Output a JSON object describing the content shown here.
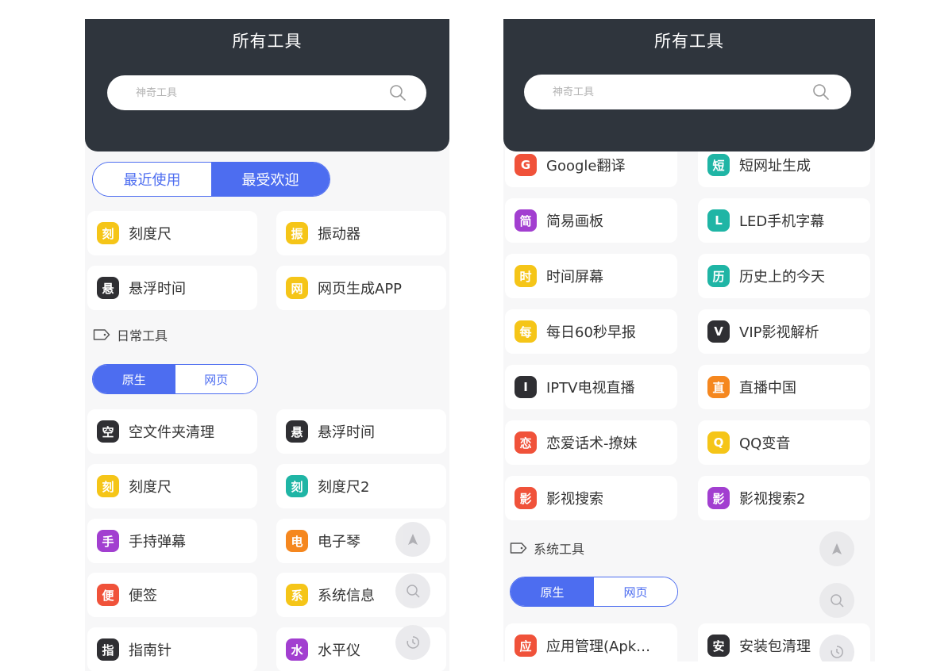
{
  "left": {
    "header": {
      "title": "所有工具"
    },
    "search": {
      "placeholder": "神奇工具"
    },
    "top_tabs": [
      {
        "label": "最近使用",
        "active": false
      },
      {
        "label": "最受欢迎",
        "active": true
      }
    ],
    "popular": [
      {
        "icon_char": "刻",
        "label": "刻度尺",
        "color": "#f5c518"
      },
      {
        "icon_char": "振",
        "label": "振动器",
        "color": "#f5c518"
      },
      {
        "icon_char": "悬",
        "label": "悬浮时间",
        "color": "#2f2f33"
      },
      {
        "icon_char": "网",
        "label": "网页生成APP",
        "color": "#f5c518"
      }
    ],
    "section": {
      "title": "日常工具",
      "icon": "tag-icon"
    },
    "sub_tabs": [
      {
        "label": "原生",
        "active": true
      },
      {
        "label": "网页",
        "active": false
      }
    ],
    "tools": [
      {
        "icon_char": "空",
        "label": "空文件夹清理",
        "color": "#2f2f33"
      },
      {
        "icon_char": "悬",
        "label": "悬浮时间",
        "color": "#2f2f33"
      },
      {
        "icon_char": "刻",
        "label": "刻度尺",
        "color": "#f5c518"
      },
      {
        "icon_char": "刻",
        "label": "刻度尺2",
        "color": "#1fb5a5"
      },
      {
        "icon_char": "手",
        "label": "手持弹幕",
        "color": "#a23fd0"
      },
      {
        "icon_char": "电",
        "label": "电子琴",
        "color": "#f5871f"
      },
      {
        "icon_char": "便",
        "label": "便签",
        "color": "#f0523a"
      },
      {
        "icon_char": "系",
        "label": "系统信息",
        "color": "#f5c518"
      },
      {
        "icon_char": "指",
        "label": "指南针",
        "color": "#2f2f33"
      },
      {
        "icon_char": "水",
        "label": "水平仪",
        "color": "#a23fd0"
      }
    ]
  },
  "right": {
    "header": {
      "title": "所有工具"
    },
    "search": {
      "placeholder": "神奇工具"
    },
    "tools": [
      {
        "icon_char": "G",
        "label": "Google翻译",
        "color": "#f0523a"
      },
      {
        "icon_char": "短",
        "label": "短网址生成",
        "color": "#1fb5a5"
      },
      {
        "icon_char": "简",
        "label": "简易画板",
        "color": "#a23fd0"
      },
      {
        "icon_char": "L",
        "label": "LED手机字幕",
        "color": "#1fb5a5"
      },
      {
        "icon_char": "时",
        "label": "时间屏幕",
        "color": "#f5c518"
      },
      {
        "icon_char": "历",
        "label": "历史上的今天",
        "color": "#1fb5a5"
      },
      {
        "icon_char": "每",
        "label": "每日60秒早报",
        "color": "#f5c518"
      },
      {
        "icon_char": "V",
        "label": "VIP影视解析",
        "color": "#2f2f33"
      },
      {
        "icon_char": "I",
        "label": "IPTV电视直播",
        "color": "#2f2f33"
      },
      {
        "icon_char": "直",
        "label": "直播中国",
        "color": "#f5871f"
      },
      {
        "icon_char": "恋",
        "label": "恋爱话术-撩妹",
        "color": "#f0523a"
      },
      {
        "icon_char": "Q",
        "label": "QQ变音",
        "color": "#f5c518"
      },
      {
        "icon_char": "影",
        "label": "影视搜索",
        "color": "#f0523a"
      },
      {
        "icon_char": "影",
        "label": "影视搜索2",
        "color": "#a23fd0"
      }
    ],
    "section": {
      "title": "系统工具",
      "icon": "tag-icon"
    },
    "sub_tabs": [
      {
        "label": "原生",
        "active": true
      },
      {
        "label": "网页",
        "active": false
      }
    ],
    "system_tools": [
      {
        "icon_char": "应",
        "label": "应用管理(Apk…",
        "color": "#f0523a"
      },
      {
        "icon_char": "安",
        "label": "安装包清理",
        "color": "#2f2f33"
      }
    ]
  },
  "floating": {
    "icons": [
      "arrow-up-icon",
      "search-icon",
      "history-icon"
    ]
  },
  "accent": "#4d6df0"
}
